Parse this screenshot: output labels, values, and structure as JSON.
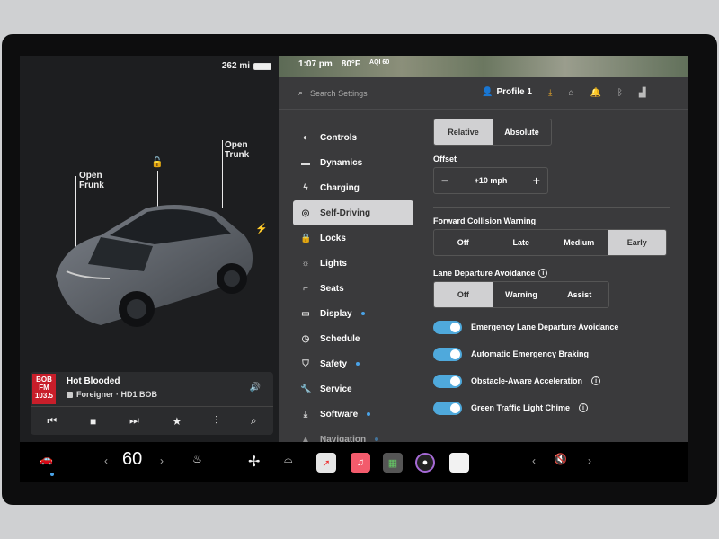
{
  "status": {
    "range": "262 mi",
    "time": "1:07 pm",
    "temp": "80°F",
    "aqi": "AQI 60"
  },
  "car": {
    "open_frunk": "Open\nFrunk",
    "open_trunk": "Open\nTrunk"
  },
  "music": {
    "song": "Hot Blooded",
    "artist": "Foreigner · HD1 BOB",
    "station_logo": "BOB\nFM\n103.5"
  },
  "header": {
    "search_placeholder": "Search Settings",
    "profile": "Profile 1"
  },
  "nav": [
    {
      "label": "Controls",
      "icon": "toggle-icon"
    },
    {
      "label": "Dynamics",
      "icon": "car-icon"
    },
    {
      "label": "Charging",
      "icon": "bolt-icon"
    },
    {
      "label": "Self-Driving",
      "icon": "steering-icon",
      "active": true
    },
    {
      "label": "Locks",
      "icon": "lock-icon"
    },
    {
      "label": "Lights",
      "icon": "sun-icon"
    },
    {
      "label": "Seats",
      "icon": "seat-icon"
    },
    {
      "label": "Display",
      "icon": "display-icon",
      "dot": true
    },
    {
      "label": "Schedule",
      "icon": "clock-icon"
    },
    {
      "label": "Safety",
      "icon": "shield-icon",
      "dot": true
    },
    {
      "label": "Service",
      "icon": "wrench-icon"
    },
    {
      "label": "Software",
      "icon": "download-icon",
      "dot": true
    },
    {
      "label": "Navigation",
      "icon": "nav-icon",
      "dot": true
    }
  ],
  "speed_mode": {
    "options": [
      "Relative",
      "Absolute"
    ],
    "selected": "Relative"
  },
  "offset": {
    "label": "Offset",
    "value": "+10 mph",
    "minus": "−",
    "plus": "+"
  },
  "fcw": {
    "label": "Forward Collision Warning",
    "options": [
      "Off",
      "Late",
      "Medium",
      "Early"
    ],
    "selected": "Early"
  },
  "lda": {
    "label": "Lane Departure Avoidance",
    "options": [
      "Off",
      "Warning",
      "Assist"
    ],
    "selected": "Off"
  },
  "toggles": [
    {
      "label": "Emergency Lane Departure Avoidance",
      "on": true,
      "info": false
    },
    {
      "label": "Automatic Emergency Braking",
      "on": true,
      "info": false
    },
    {
      "label": "Obstacle-Aware Acceleration",
      "on": true,
      "info": true
    },
    {
      "label": "Green Traffic Light Chime",
      "on": true,
      "info": true
    }
  ],
  "dock": {
    "temperature": "60"
  }
}
